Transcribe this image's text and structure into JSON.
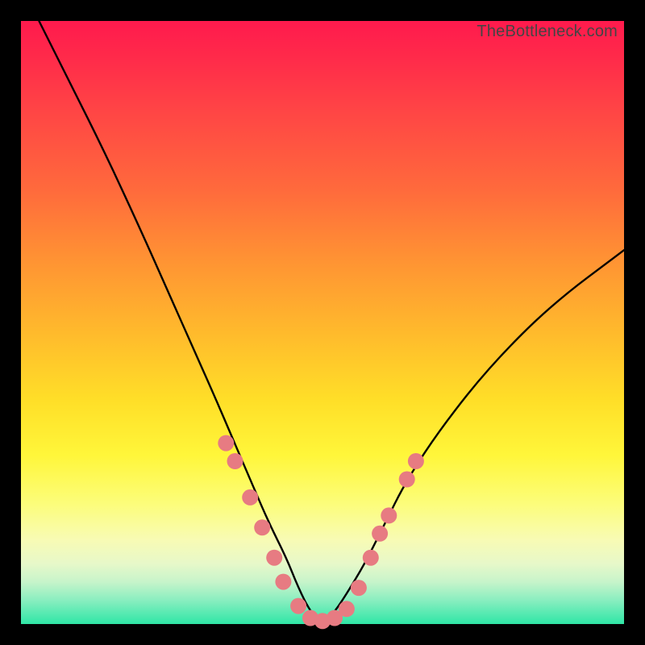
{
  "watermark": "TheBottleneck.com",
  "chart_data": {
    "type": "line",
    "title": "",
    "xlabel": "",
    "ylabel": "",
    "xlim": [
      0,
      100
    ],
    "ylim": [
      0,
      100
    ],
    "series": [
      {
        "name": "bottleneck-curve",
        "x": [
          3,
          8,
          14,
          20,
          24,
          28,
          32,
          35,
          38,
          41,
          44,
          46,
          48,
          50,
          52,
          54,
          57,
          60,
          64,
          70,
          78,
          88,
          100
        ],
        "values": [
          100,
          90,
          78,
          65,
          56,
          47,
          38,
          31,
          24,
          17,
          11,
          6,
          2,
          0,
          2,
          5,
          10,
          16,
          24,
          33,
          43,
          53,
          62
        ]
      }
    ],
    "markers": {
      "name": "highlight-dots",
      "color": "#e77b82",
      "radius_px": 10,
      "points": [
        {
          "x": 34,
          "y": 30
        },
        {
          "x": 35.5,
          "y": 27
        },
        {
          "x": 38,
          "y": 21
        },
        {
          "x": 40,
          "y": 16
        },
        {
          "x": 42,
          "y": 11
        },
        {
          "x": 43.5,
          "y": 7
        },
        {
          "x": 46,
          "y": 3
        },
        {
          "x": 48,
          "y": 1
        },
        {
          "x": 50,
          "y": 0.5
        },
        {
          "x": 52,
          "y": 1
        },
        {
          "x": 54,
          "y": 2.5
        },
        {
          "x": 56,
          "y": 6
        },
        {
          "x": 58,
          "y": 11
        },
        {
          "x": 59.5,
          "y": 15
        },
        {
          "x": 61,
          "y": 18
        },
        {
          "x": 64,
          "y": 24
        },
        {
          "x": 65.5,
          "y": 27
        }
      ]
    },
    "gradient_stops": [
      {
        "pos": 0,
        "color": "#ff1a4d"
      },
      {
        "pos": 15,
        "color": "#ff4545"
      },
      {
        "pos": 40,
        "color": "#ff9433"
      },
      {
        "pos": 63,
        "color": "#ffdf28"
      },
      {
        "pos": 80,
        "color": "#fcfd7a"
      },
      {
        "pos": 93,
        "color": "#c7f4ca"
      },
      {
        "pos": 100,
        "color": "#2fe6a6"
      }
    ]
  }
}
